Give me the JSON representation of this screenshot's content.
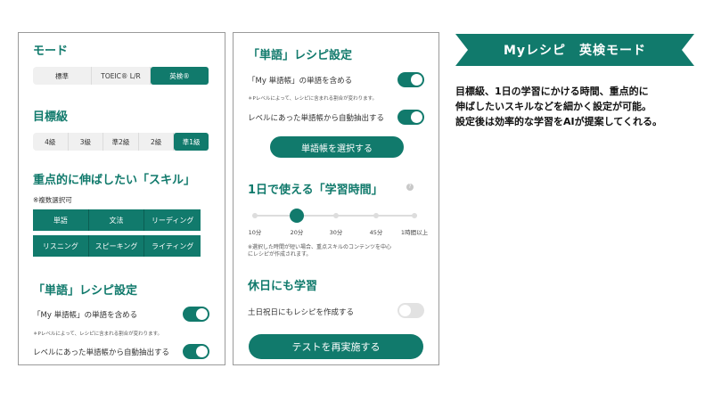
{
  "left_panel": {
    "mode_heading": "モード",
    "mode_options": [
      "標準",
      "TOEIC® L/R",
      "英検®"
    ],
    "level_heading": "目標級",
    "level_options": [
      "4級",
      "3級",
      "準2級",
      "2級",
      "準1級"
    ],
    "skill_heading": "重点的に伸ばしたい「スキル」",
    "multi_select_note": "※複数選択可",
    "skills": [
      "単語",
      "文法",
      "リーディング",
      "リスニング",
      "スピーキング",
      "ライティング"
    ],
    "vocab_heading": "「単語」レシピ設定",
    "include_my_vocab": "「My 単語帳」の単語を含める",
    "p_level_note": "＊Pレベルによって、レシピに含まれる割合が変わります。",
    "auto_extract": "レベルにあった単語帳から自動抽出する"
  },
  "mid_panel": {
    "vocab_heading": "「単語」レシピ設定",
    "include_my_vocab": "「My 単語帳」の単語を含める",
    "p_level_note": "＊Pレベルによって、レシピに含まれる割合が変わります。",
    "auto_extract": "レベルにあった単語帳から自動抽出する",
    "select_vocab_button": "単語帳を選択する",
    "time_heading": "1日で使える「学習時間」",
    "info_icon_glyph": "?",
    "time_options": [
      "10分",
      "20分",
      "30分",
      "45分",
      "1時間以上"
    ],
    "time_note_line1": "※選択した時間が短い場合、重点スキルのコンテンツを中心",
    "time_note_line2": "にレシピが作成されます。",
    "holiday_heading": "休日にも学習",
    "holiday_option": "土日祝日にもレシピを作成する",
    "retest_button": "テストを再実施する"
  },
  "banner": {
    "title": "Myレシピ　英検モード"
  },
  "description": {
    "line1": "目標級、1日の学習にかける時間、重点的に",
    "line2": "伸ばしたいスキルなどを細かく設定が可能。",
    "line3": "設定後は効率的な学習をAIが提案してくれる。"
  },
  "colors": {
    "accent": "#117a6c",
    "toggle_off": "#e2e2e2",
    "segment_bg": "#f0f0f0"
  }
}
